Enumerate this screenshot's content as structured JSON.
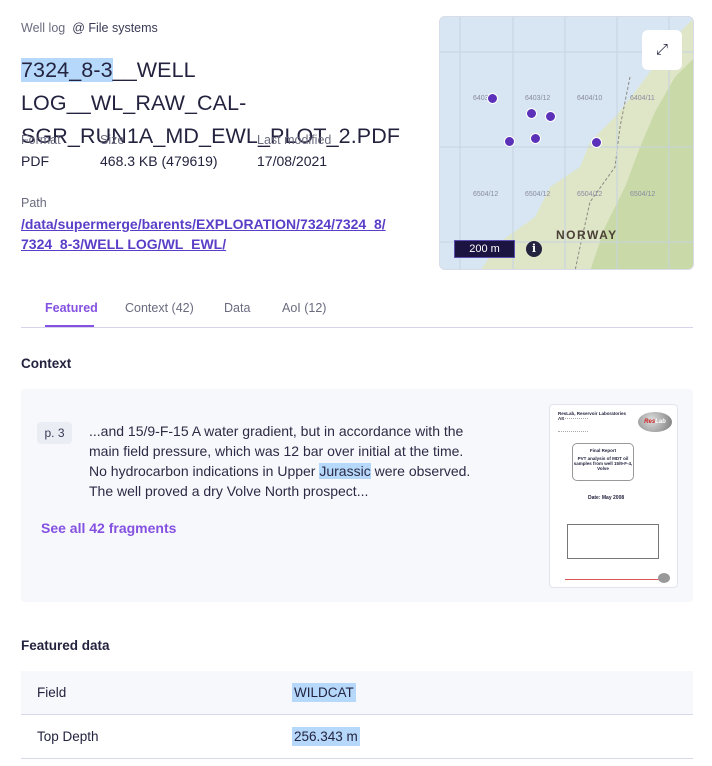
{
  "header": {
    "type": "Well log",
    "source": "@ File systems"
  },
  "title": {
    "highlight": "7324_8-3",
    "rest": "__WELL LOG__WL_RAW_CAL-SGR_RUN1A_MD_EWL_PLOT_2.PDF"
  },
  "meta": {
    "format_label": "Format",
    "format_value": "PDF",
    "size_label": "Size",
    "size_value": "468.3 KB (479619)",
    "modified_label": "Last modified",
    "modified_value": "17/08/2021"
  },
  "path": {
    "label": "Path",
    "value": "/data/supermerge/barents/EXPLORATION/7324/7324_8/7324_8-3/WELL LOG/WL_EWL/"
  },
  "map": {
    "grid_labels_top": [
      "6403/",
      "6403/12",
      "6404/10",
      "6404/11"
    ],
    "grid_labels_bottom": [
      "6504/12",
      "6504/12",
      "6504/12",
      "6504/12"
    ],
    "country_label": "NORWAY",
    "scale": "200 m",
    "expand_icon": "expand-icon",
    "info_icon": "info-icon",
    "marker_color": "#5a31b8"
  },
  "tabs": [
    {
      "label": "Featured",
      "active": true
    },
    {
      "label": "Context (42)"
    },
    {
      "label": "Data"
    },
    {
      "label": "AoI (12)"
    }
  ],
  "context": {
    "heading": "Context",
    "page": "p. 3",
    "text_before": "...and 15/9-F-15 A water gradient, but in accordance with the main field pressure, which was 12 bar over initial at the time. No hydrocarbon indications in Upper ",
    "text_highlight": "Jurassic",
    "text_after": " were observed. The well proved a dry Volve North prospect...",
    "see_all": "See all 42 fragments",
    "thumbnail": {
      "company": "ResLab, Reservoir Laboratories AS",
      "report_title": "Final Report",
      "report_subtitle": "PVT analysis of MDT oil samples from well 15/9-F-4, Volve",
      "date": "Date: May 2008",
      "logo": "ResLab"
    }
  },
  "featured_data": {
    "heading": "Featured data",
    "rows": [
      {
        "key": "Field",
        "value": "WILDCAT"
      },
      {
        "key": "Top Depth",
        "value": "256.343 m"
      }
    ]
  },
  "colors": {
    "accent": "#8451e0",
    "link": "#5b3ec8",
    "highlight": "#b6d8fb"
  }
}
